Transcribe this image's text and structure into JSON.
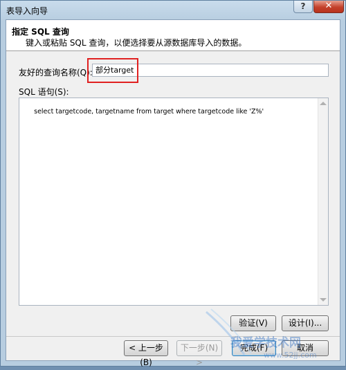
{
  "window": {
    "title": "表导入向导",
    "help_label": "?",
    "close_label": "✕"
  },
  "header": {
    "title": "指定 SQL 查询",
    "subtitle": "键入或粘贴 SQL 查询，以便选择要从源数据库导入的数据。"
  },
  "friendly_name": {
    "label": "友好的查询名称(Q):",
    "value": "部分target"
  },
  "sql": {
    "label": "SQL 语句(S):",
    "statement": "select targetcode, targetname from target where targetcode like 'Z%'"
  },
  "buttons": {
    "validate": "验证(V)",
    "design": "设计(I)...",
    "back": "< 上一步(B)",
    "next": "下一步(N) >",
    "finish": "完成(F)",
    "cancel": "取消"
  },
  "watermark": {
    "text": "我爱学技术网",
    "url": "www.52jj.com"
  },
  "colors": {
    "highlight_box": "#e02020",
    "close_button": "#c4412c"
  }
}
